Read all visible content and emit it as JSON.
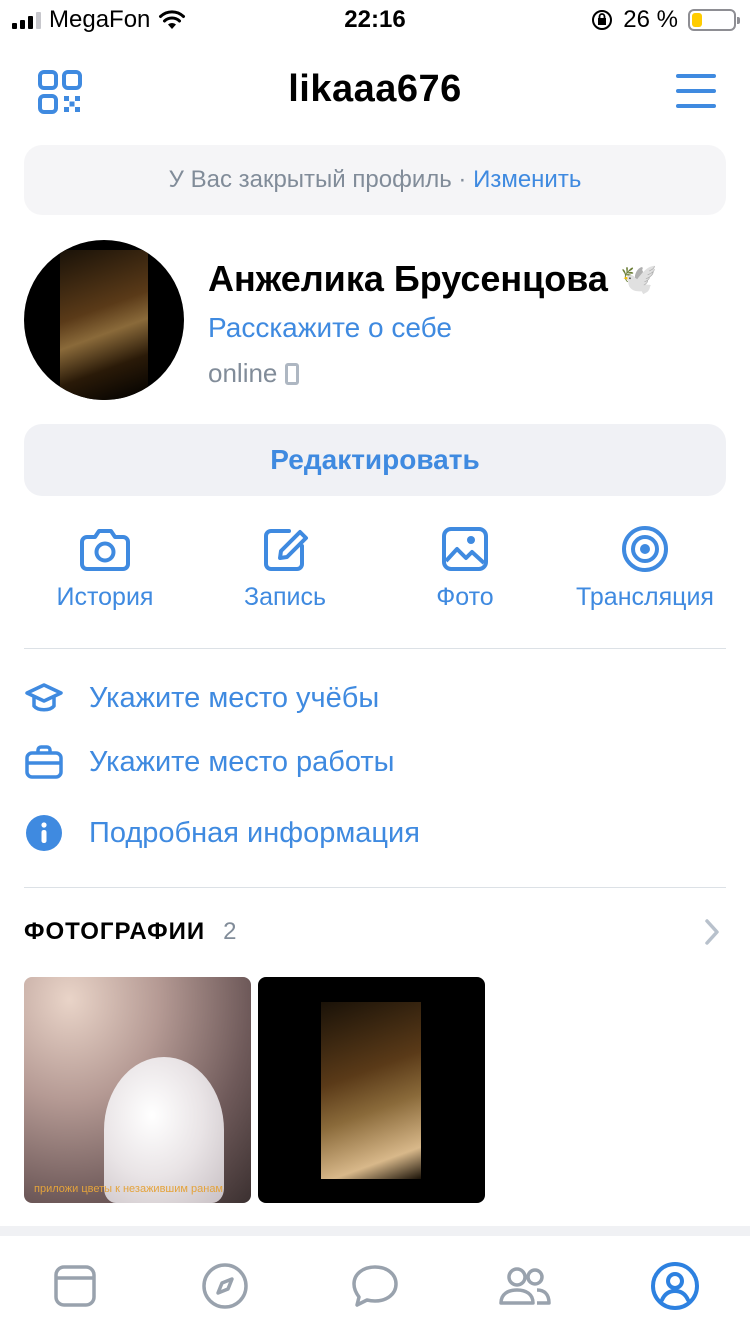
{
  "status_bar": {
    "carrier": "MegaFon",
    "time": "22:16",
    "battery_percent": "26 %",
    "battery_level": 0.26
  },
  "header": {
    "username": "likaaa676"
  },
  "private_banner": {
    "text": "У Вас закрытый профиль · ",
    "link": "Изменить"
  },
  "profile": {
    "name": "Анжелика Брусенцова",
    "emoji": "🕊️",
    "about_link": "Расскажите о себе",
    "status": "online"
  },
  "edit_button": "Редактировать",
  "actions": [
    {
      "label": "История",
      "icon": "camera-icon"
    },
    {
      "label": "Запись",
      "icon": "edit-post-icon"
    },
    {
      "label": "Фото",
      "icon": "photo-icon"
    },
    {
      "label": "Трансляция",
      "icon": "broadcast-icon"
    }
  ],
  "info": [
    {
      "label": "Укажите место учёбы",
      "icon": "graduation-cap-icon"
    },
    {
      "label": "Укажите место работы",
      "icon": "briefcase-icon"
    },
    {
      "label": "Подробная информация",
      "icon": "info-icon"
    }
  ],
  "photos": {
    "heading": "ФОТОГРАФИИ",
    "count": "2",
    "items": [
      {
        "caption": "приложи цветы к незажившим ранам"
      },
      {
        "caption": ""
      }
    ]
  },
  "tabbar": [
    {
      "icon": "feed-icon",
      "active": false
    },
    {
      "icon": "compass-icon",
      "active": false
    },
    {
      "icon": "messages-icon",
      "active": false
    },
    {
      "icon": "friends-icon",
      "active": false
    },
    {
      "icon": "profile-icon",
      "active": true
    }
  ],
  "colors": {
    "accent": "#3f8ae0",
    "muted": "#818c99",
    "inactive_icon": "#99a2ad"
  }
}
